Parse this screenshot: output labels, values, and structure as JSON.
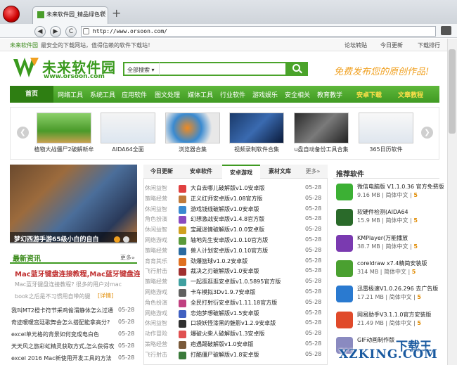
{
  "browser": {
    "tab_title": "未来软件园_精品绿色软",
    "tab_close": "×",
    "new_tab": "+",
    "url": "http://www.orsoon.com/",
    "back": "◀",
    "forward": "▶",
    "reload": "C",
    "menu_arrow": "▼"
  },
  "site": {
    "topbar": {
      "name": "未来软件园",
      "slogan": "最安全的下载网站，值得信赖的软件下载站！",
      "links": [
        "论坛转贴",
        "今日更新",
        "下载排行"
      ]
    },
    "logo": {
      "cn": "未来软件园",
      "url": "www.orsoon.com"
    },
    "search": {
      "select": "全部搜索 ▾"
    },
    "promo": "免费发布您的原创作品!",
    "nav": [
      "网络工具",
      "系统工具",
      "应用软件",
      "图文处理",
      "媒体工具",
      "行业软件",
      "游戏娱乐",
      "安全相关",
      "教育教学"
    ],
    "nav_home": "首页",
    "nav_highlight": [
      "安卓下载",
      "文章教程"
    ],
    "carousel": [
      {
        "caption": "植物大战僵尸2破解新牟"
      },
      {
        "caption": "AIDA64全面"
      },
      {
        "caption": "浏览器合集"
      },
      {
        "caption": "视频录制软件合集"
      },
      {
        "caption": "u盘自动备份工具合集"
      },
      {
        "caption": "365日历软件"
      }
    ],
    "carousel_prev": "❮",
    "carousel_next": "❯",
    "banner_caption": "梦幻西游手游65级小白的自白",
    "news": {
      "title": "最新资讯",
      "more": "更多»",
      "headline": "Mac蓝牙键盘连接教程,Mac蓝牙键盘连接",
      "headline2": "Mac蓝牙键盘连接",
      "summary1": "Mac蓝牙键盘连接教程? 很多的用户对mac",
      "summary2": "book之后是不习惯用自带的键",
      "detail": "[详情]",
      "items": [
        {
          "title": "我叫MT2橙卡符节采鸡偷渭静体怎么过通",
          "date": "05-28"
        },
        {
          "title": "奇迹暖暖宫廷歌舞会怎么搭配能拿高分?",
          "date": "05-28"
        },
        {
          "title": "excel单元格的背景如何变成电白色",
          "date": "05-28"
        },
        {
          "title": "天天风之旅彩虹精灵获取方式,怎么获得攻",
          "date": "05-28"
        },
        {
          "title": "excel 2016 Mac新使用开发工具的方法",
          "date": "05-28"
        }
      ]
    },
    "mid_tabs": [
      "今日更新",
      "安卓软件",
      "安卓游戏",
      "素材文库",
      "更多»"
    ],
    "mid_rows": [
      {
        "cat": "休闲益智",
        "title": "大白去哪儿破解版v1.0安卓版",
        "date": "05-28",
        "color": "#e04040"
      },
      {
        "cat": "策略经营",
        "title": "正义红师安卓版v1.08官方版",
        "date": "05-28",
        "color": "#c07a3a"
      },
      {
        "cat": "休闲益智",
        "title": "游戏钱线破解版v1.0安卓版",
        "date": "05-28",
        "color": "#3a8ad0"
      },
      {
        "cat": "角色扮演",
        "title": "幻想激战安卓版v1.4.8官方版",
        "date": "05-28",
        "color": "#8a4ac0"
      },
      {
        "cat": "休闲益智",
        "title": "宝藏迷情破解版v1.0.0安卓版",
        "date": "05-28",
        "color": "#d0a020"
      },
      {
        "cat": "网络游戏",
        "title": "轴地先生安卓版v1.0.10官方版",
        "date": "05-28",
        "color": "#5a9a3a"
      },
      {
        "cat": "策略经营",
        "title": "兽人计划安卓版v1.0.10官方版",
        "date": "05-28",
        "color": "#2a6aa0"
      },
      {
        "cat": "育育其乐",
        "title": "劲爆篮球v1.0.2安卓版",
        "date": "05-28",
        "color": "#e07020"
      },
      {
        "cat": "飞行射击",
        "title": "裁决之刃破解版v1.0安卓版",
        "date": "05-28",
        "color": "#a03030"
      },
      {
        "cat": "策略经营",
        "title": "一起逛逛逛安卓版v1.0.5895官方版",
        "date": "05-28",
        "color": "#40a0a0"
      },
      {
        "cat": "网络游戏",
        "title": "卡车模拟3Dv1.9.7安卓版",
        "date": "05-28",
        "color": "#606060"
      },
      {
        "cat": "角色扮演",
        "title": "全民打射衍安卓版v1.11.18官方版",
        "date": "05-28",
        "color": "#c04080"
      },
      {
        "cat": "网络游戏",
        "title": "恋炮梦想破解版v1.5安卓版",
        "date": "05-28",
        "color": "#4060c0"
      },
      {
        "cat": "休闲益智",
        "title": "口袋妖怪漆黑的魅影v1.2.9安卓版",
        "date": "05-28",
        "color": "#303030"
      },
      {
        "cat": "动作冒险",
        "title": "爆破火柴人破解版v1.3安卓版",
        "date": "05-28",
        "color": "#e05050"
      },
      {
        "cat": "策略经营",
        "title": "疤遇踢破解版v1.0安卓版",
        "date": "05-28",
        "color": "#7a5a3a"
      },
      {
        "cat": "飞行射击",
        "title": "打酷僵尸破解版v1.8安卓版",
        "date": "05-28",
        "color": "#3a7a3a"
      }
    ],
    "recommended": {
      "title": "推荐软件",
      "items": [
        {
          "name": "微信电脑版 V1.1.0.36 官方免费版",
          "size": "9.16 MB",
          "lang": "简体中文",
          "score": "5",
          "color": "#3cb034"
        },
        {
          "name": "软硬件检测(AIDA64",
          "size": "15.9 MB",
          "lang": "简体中文",
          "score": "5",
          "color": "#2a6a2a"
        },
        {
          "name": "KMPlayer(万能播放",
          "size": "38.7 MB",
          "lang": "简体中文",
          "score": "5",
          "color": "#7a3ab0"
        },
        {
          "name": "coreldraw x7.4精简安装版",
          "size": "314 MB",
          "lang": "简体中文",
          "score": "5",
          "color": "#4aa030"
        },
        {
          "name": "迅雷极速V1.0.26.296 去广告版",
          "size": "17.21 MB",
          "lang": "简体中文",
          "score": "5",
          "color": "#2a7ad0"
        },
        {
          "name": "网易助手V3.1.1.0官方安装版",
          "size": "21.49 MB",
          "lang": "简体中文",
          "score": "5",
          "color": "#e04a2a"
        },
        {
          "name": "GIF动画制作版",
          "size": "",
          "lang": "",
          "score": "",
          "color": "#8a8ac0"
        }
      ]
    }
  },
  "watermark": {
    "line1": "下载王",
    "line2": "XZKING.COM"
  }
}
